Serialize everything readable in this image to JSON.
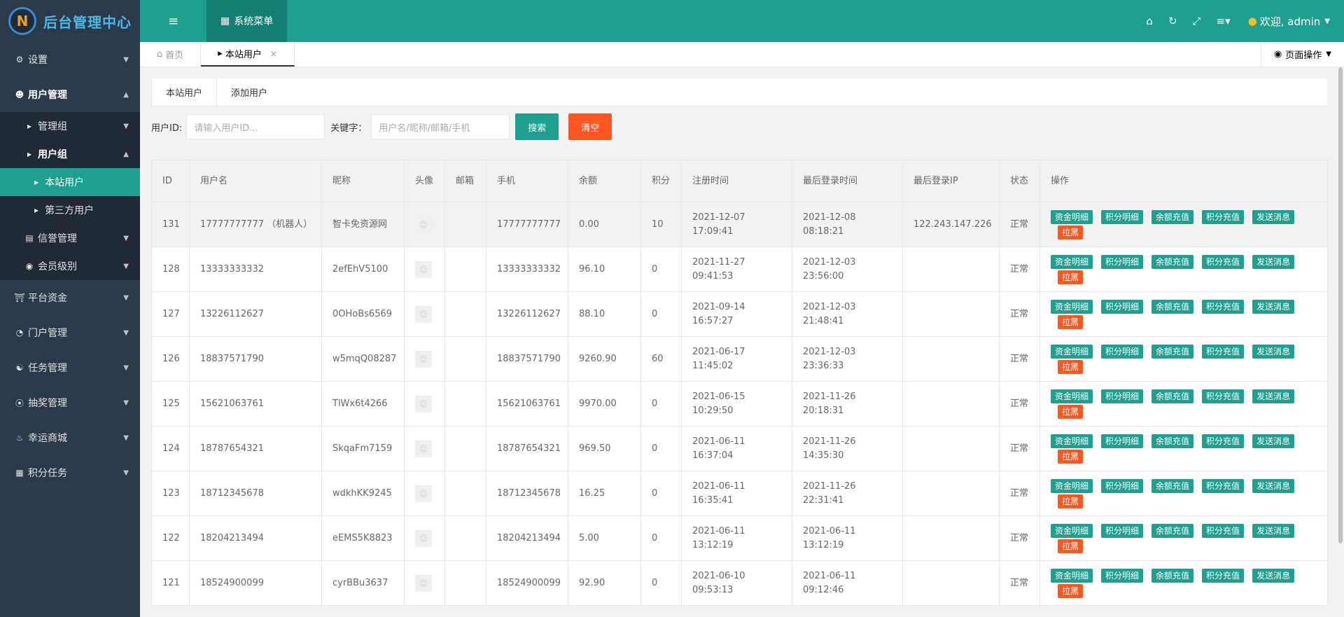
{
  "header": {
    "logo_letter": "N",
    "title": "后台管理中心",
    "system_menu": "系统菜单",
    "welcome": "欢迎, admin"
  },
  "sidebar": {
    "settings": "设置",
    "user_mgmt": "用户管理",
    "admin_group": "管理组",
    "user_group": "用户组",
    "site_users": "本站用户",
    "third_party_users": "第三方用户",
    "credit_mgmt": "信誉管理",
    "member_level": "会员级别",
    "platform_funds": "平台资金",
    "portal_mgmt": "门户管理",
    "task_mgmt": "任务管理",
    "lottery_mgmt": "抽奖管理",
    "lucky_mall": "幸运商城",
    "points_task": "积分任务"
  },
  "tabbar": {
    "home": "首页",
    "current": "本站用户",
    "page_ops": "页面操作"
  },
  "subtabs": {
    "site_users": "本站用户",
    "add_user": "添加用户"
  },
  "search": {
    "uid_label": "用户ID:",
    "uid_placeholder": "请输入用户ID...",
    "keyword_label": "关键字：",
    "keyword_placeholder": "用户名/昵称/邮箱/手机",
    "search_btn": "搜索",
    "clear_btn": "清空"
  },
  "table": {
    "headers": [
      "ID",
      "用户名",
      "昵称",
      "头像",
      "邮箱",
      "手机",
      "余额",
      "积分",
      "注册时间",
      "最后登录时间",
      "最后登录IP",
      "状态",
      "操作"
    ],
    "ops": [
      "资金明细",
      "积分明细",
      "余额充值",
      "积分充值",
      "发送消息",
      "拉黑"
    ],
    "rows": [
      {
        "id": "131",
        "username": "17777777777 （机器人）",
        "nickname": "智卡免资源网",
        "email": "",
        "phone": "17777777777",
        "balance": "0.00",
        "points": "10",
        "reg": "2021-12-07 17:09:41",
        "last": "2021-12-08 08:18:21",
        "ip": "122.243.147.226",
        "status": "正常"
      },
      {
        "id": "128",
        "username": "13333333332",
        "nickname": "2efEhV5100",
        "email": "",
        "phone": "13333333332",
        "balance": "96.10",
        "points": "0",
        "reg": "2021-11-27 09:41:53",
        "last": "2021-12-03 23:56:00",
        "ip": "",
        "status": "正常"
      },
      {
        "id": "127",
        "username": "13226112627",
        "nickname": "0OHoBs6569",
        "email": "",
        "phone": "13226112627",
        "balance": "88.10",
        "points": "0",
        "reg": "2021-09-14 16:57:27",
        "last": "2021-12-03 21:48:41",
        "ip": "",
        "status": "正常"
      },
      {
        "id": "126",
        "username": "18837571790",
        "nickname": "w5mqQ08287",
        "email": "",
        "phone": "18837571790",
        "balance": "9260.90",
        "points": "60",
        "reg": "2021-06-17 11:45:02",
        "last": "2021-12-03 23:36:33",
        "ip": "",
        "status": "正常"
      },
      {
        "id": "125",
        "username": "15621063761",
        "nickname": "TlWx6t4266",
        "email": "",
        "phone": "15621063761",
        "balance": "9970.00",
        "points": "0",
        "reg": "2021-06-15 10:29:50",
        "last": "2021-11-26 20:18:31",
        "ip": "",
        "status": "正常"
      },
      {
        "id": "124",
        "username": "18787654321",
        "nickname": "SkqaFm7159",
        "email": "",
        "phone": "18787654321",
        "balance": "969.50",
        "points": "0",
        "reg": "2021-06-11 16:37:04",
        "last": "2021-11-26 14:35:30",
        "ip": "",
        "status": "正常"
      },
      {
        "id": "123",
        "username": "18712345678",
        "nickname": "wdkhKK9245",
        "email": "",
        "phone": "18712345678",
        "balance": "16.25",
        "points": "0",
        "reg": "2021-06-11 16:35:41",
        "last": "2021-11-26 22:31:41",
        "ip": "",
        "status": "正常"
      },
      {
        "id": "122",
        "username": "18204213494",
        "nickname": "eEMS5K8823",
        "email": "",
        "phone": "18204213494",
        "balance": "5.00",
        "points": "0",
        "reg": "2021-06-11 13:12:19",
        "last": "2021-06-11 13:12:19",
        "ip": "",
        "status": "正常"
      },
      {
        "id": "121",
        "username": "18524900099",
        "nickname": "cyrBBu3637",
        "email": "",
        "phone": "18524900099",
        "balance": "92.90",
        "points": "0",
        "reg": "2021-06-10 09:53:13",
        "last": "2021-06-11 09:12:46",
        "ip": "",
        "status": "正常"
      }
    ]
  }
}
